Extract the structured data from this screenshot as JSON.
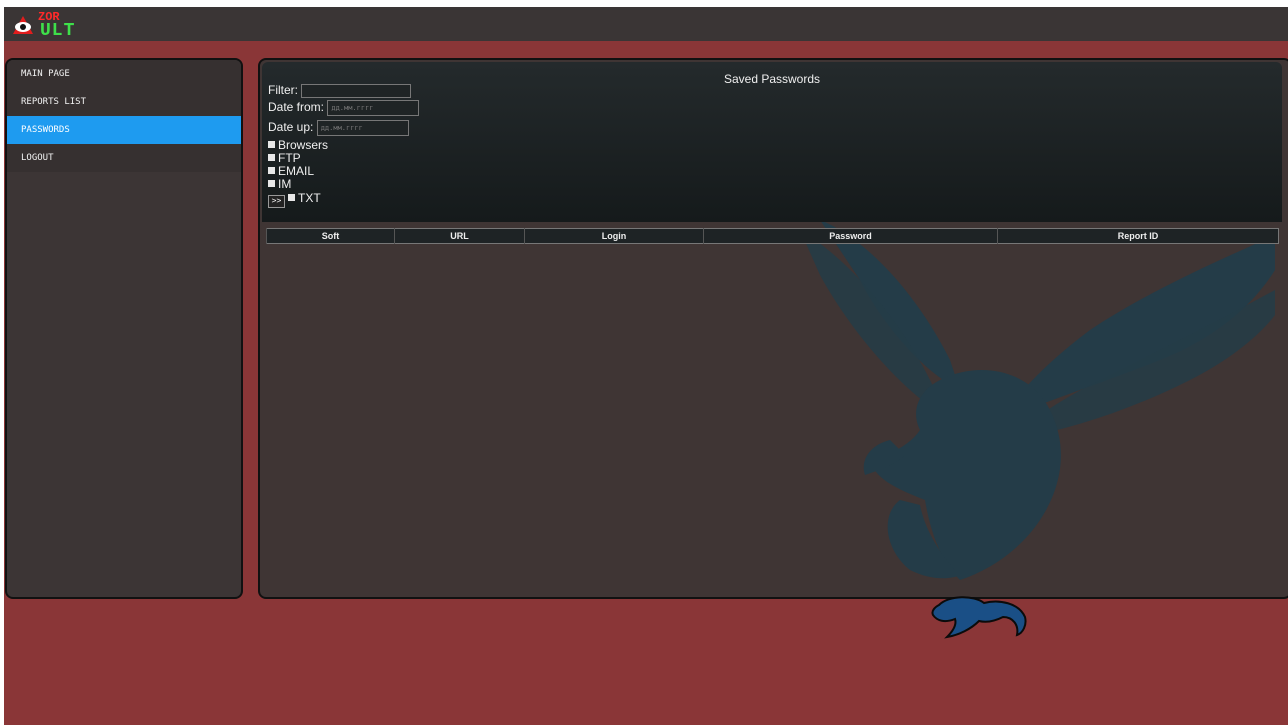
{
  "brand": {
    "line1": "ZOR",
    "line2": "ULT",
    "logo_icon": "eye-icon"
  },
  "sidebar": {
    "items": [
      {
        "label": "MAIN PAGE",
        "active": false
      },
      {
        "label": "REPORTS LIST",
        "active": false
      },
      {
        "label": "PASSWORDS",
        "active": true
      },
      {
        "label": "LOGOUT",
        "active": false
      }
    ]
  },
  "panel": {
    "title": "Saved Passwords",
    "filter_label": "Filter:",
    "filter_value": "",
    "date_from_label": "Date from:",
    "date_from_placeholder": "дд.мм.гггг",
    "date_up_label": "Date up:",
    "date_up_placeholder": "дд.мм.гггг",
    "checkboxes": [
      "Browsers",
      "FTP",
      "EMAIL",
      "IM",
      "TXT"
    ],
    "go_button": ">>"
  },
  "table": {
    "columns": [
      "Soft",
      "URL",
      "Login",
      "Password",
      "Report ID"
    ]
  },
  "colors": {
    "page_bg": "#8a3637",
    "topbar": "#3a3535",
    "panel_bg": "#3f3534",
    "active_nav": "#1e9bf0",
    "eagle": "#243c48",
    "talons": "#1a4f86"
  }
}
